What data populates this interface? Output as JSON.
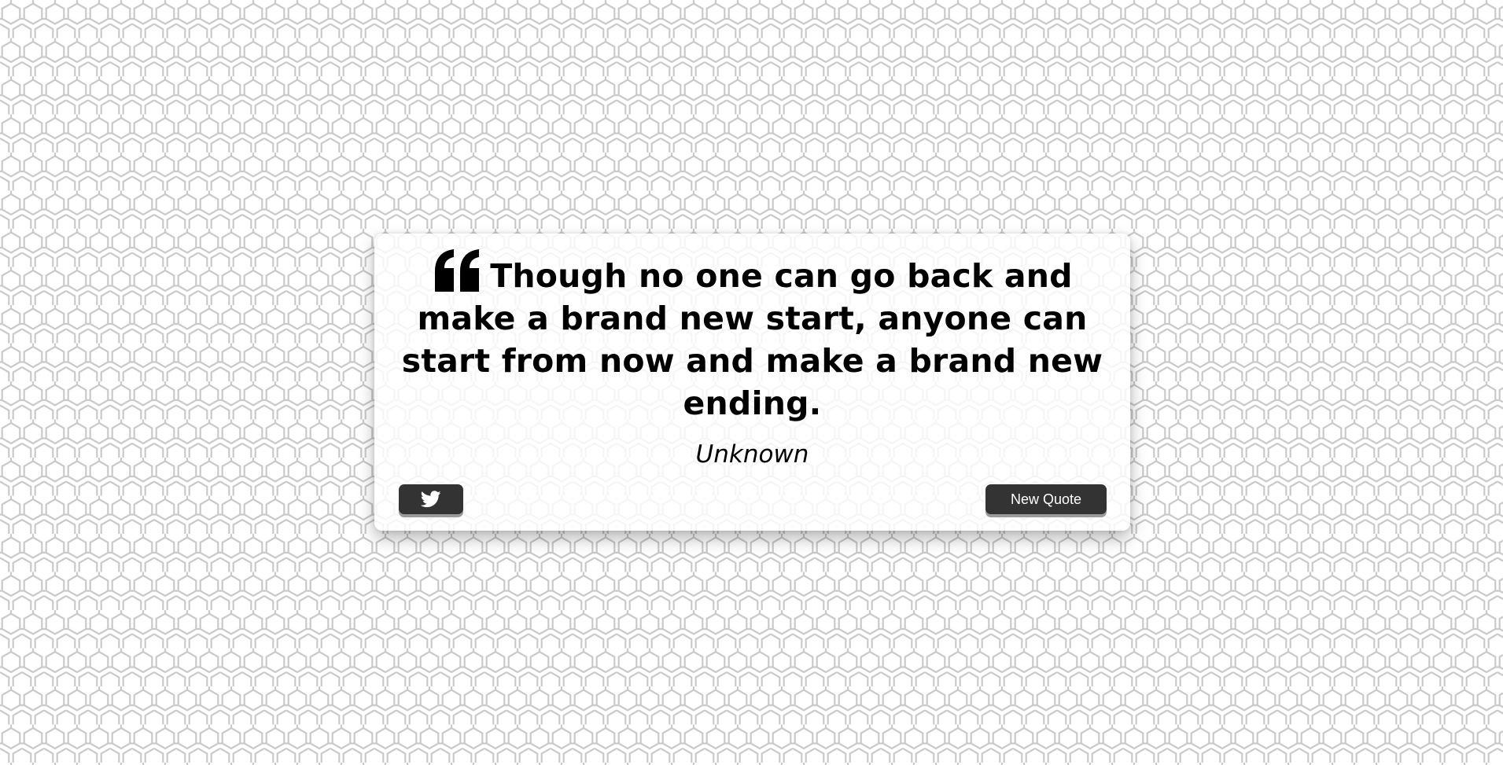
{
  "quote": {
    "text": "Though no one can go back and make a brand new start, anyone can start from now and make a brand new ending.",
    "author": "Unknown"
  },
  "actions": {
    "tweet_icon": "twitter-icon",
    "new_quote_label": "New Quote"
  },
  "colors": {
    "button_bg": "#333333",
    "button_text": "#ffffff",
    "quote_text": "#000000"
  }
}
